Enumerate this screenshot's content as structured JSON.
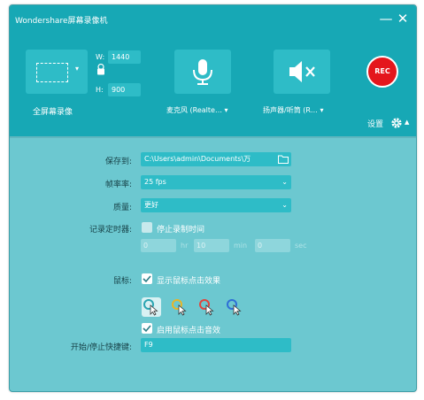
{
  "window": {
    "title": "Wondershare屏幕录像机"
  },
  "screen": {
    "label": "全屏幕录像",
    "width_label": "W:",
    "width": "1440",
    "height_label": "H:",
    "height": "900"
  },
  "mic": {
    "label": "麦克风 (Realte… ▾"
  },
  "speaker": {
    "label": "扬声器/听筒 (R… ▾"
  },
  "record": {
    "label": "REC"
  },
  "settings": {
    "label": "设置"
  },
  "form": {
    "save_to_label": "保存到:",
    "save_to_value": "C:\\Users\\admin\\Documents\\万",
    "fps_label": "帧率率:",
    "fps_value": "25 fps",
    "quality_label": "质量:",
    "quality_value": "更好",
    "timer_label": "记录定时器:",
    "timer_checkbox": "停止录制时间",
    "timer_h": "0",
    "timer_h_unit": "hr",
    "timer_m": "10",
    "timer_m_unit": "min",
    "timer_s": "0",
    "timer_s_unit": "sec",
    "mouse_label": "鼠标:",
    "mouse_click_effect": "显示鼠标点击效果",
    "mouse_click_sound": "启用鼠标点击音效",
    "hotkey_label": "开始/停止快捷键:",
    "hotkey_value": "F9"
  },
  "colors": {
    "header": "#17a8b5",
    "body": "#6cc8d0",
    "field": "#2ebcc7",
    "rec": "#e4161c"
  },
  "icons": [
    "minimize-icon",
    "close-icon",
    "lock-icon",
    "microphone-icon",
    "speaker-mute-icon",
    "gear-icon",
    "folder-icon",
    "cursor-icon"
  ]
}
